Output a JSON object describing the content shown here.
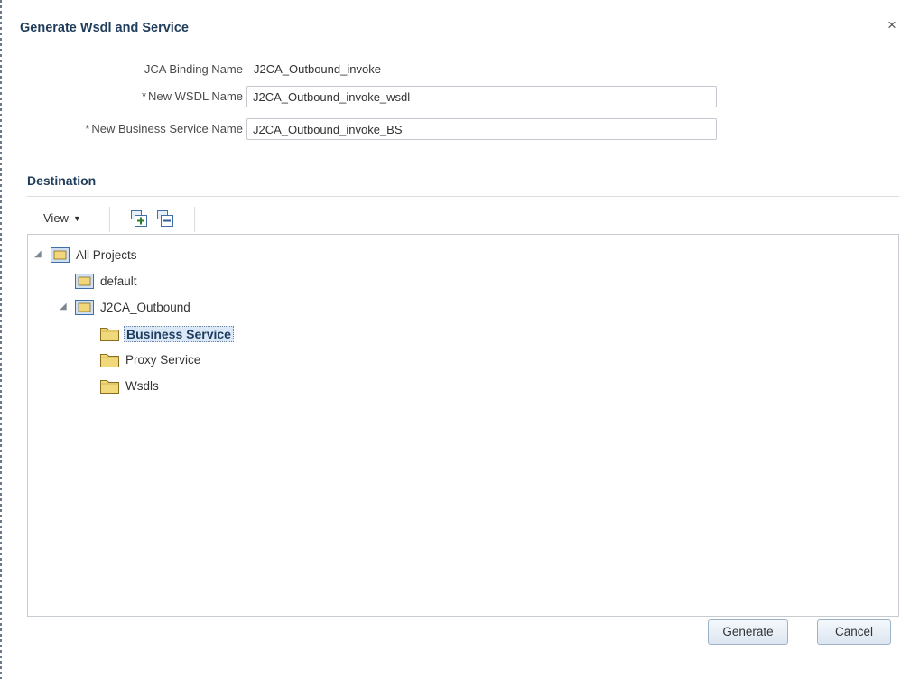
{
  "dialog": {
    "title": "Generate Wsdl and Service",
    "close_glyph": "×"
  },
  "form": {
    "jca_binding": {
      "label": "JCA Binding Name",
      "value": "J2CA_Outbound_invoke"
    },
    "wsdl_name": {
      "required_marker": "*",
      "label": "New WSDL Name",
      "value": "J2CA_Outbound_invoke_wsdl"
    },
    "business_service_name": {
      "required_marker": "*",
      "label": "New Business Service Name",
      "value": "J2CA_Outbound_invoke_BS"
    }
  },
  "destination": {
    "title": "Destination",
    "toolbar": {
      "view_label": "View",
      "view_caret": "▼",
      "icons": [
        "expand-all-icon",
        "collapse-all-icon"
      ]
    },
    "tree": {
      "root": {
        "label": "All Projects",
        "expanded": true
      },
      "default": {
        "label": "default"
      },
      "j2ca": {
        "label": "J2CA_Outbound",
        "expanded": true
      },
      "business_service": {
        "label": "Business Service",
        "selected": true
      },
      "proxy_service": {
        "label": "Proxy Service"
      },
      "wsdls": {
        "label": "Wsdls"
      }
    },
    "expander_glyph": "◢"
  },
  "actions": {
    "generate_label": "Generate",
    "cancel_label": "Cancel"
  },
  "colors": {
    "title": "#1f3c5a",
    "selection_bg": "#dbe8f7",
    "folder": "#f0d97a",
    "button_border": "#9fb1c6"
  }
}
